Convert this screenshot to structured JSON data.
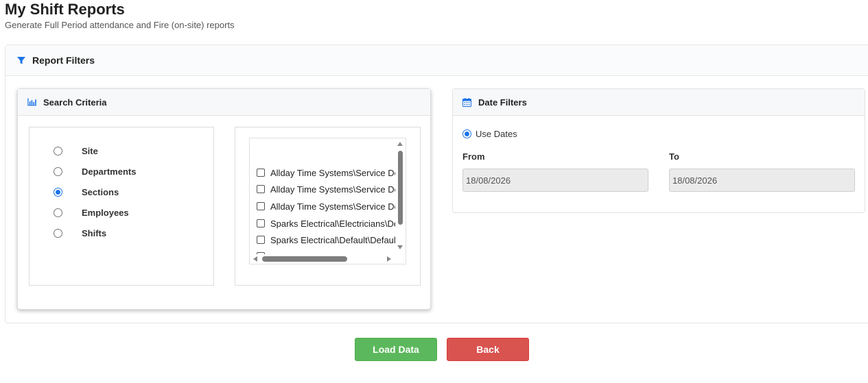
{
  "page": {
    "title": "My Shift Reports",
    "subtitle": "Generate Full Period attendance and Fire (on-site) reports"
  },
  "report_filters": {
    "title": "Report Filters",
    "icon": "filter-icon"
  },
  "search_criteria": {
    "title": "Search Criteria",
    "icon": "bar-chart-icon",
    "options": [
      {
        "label": "Site",
        "checked": false
      },
      {
        "label": "Departments",
        "checked": false
      },
      {
        "label": "Sections",
        "checked": true
      },
      {
        "label": "Employees",
        "checked": false
      },
      {
        "label": "Shifts",
        "checked": false
      }
    ],
    "list_items": [
      "Allday Time Systems\\Service De",
      "Allday Time Systems\\Service De",
      "Allday Time Systems\\Service De",
      "Sparks Electrical\\Electricians\\De",
      "Sparks Electrical\\Default\\Defaul"
    ]
  },
  "date_filters": {
    "title": "Date Filters",
    "icon": "calendar-icon",
    "use_dates_label": "Use Dates",
    "use_dates_checked": true,
    "from_label": "From",
    "from_value": "18/08/2026",
    "to_label": "To",
    "to_value": "18/08/2026"
  },
  "actions": {
    "load_label": "Load Data",
    "back_label": "Back"
  },
  "colors": {
    "accent": "#1a73e8",
    "load_button": "#5cb85c",
    "back_button": "#d9534f"
  }
}
